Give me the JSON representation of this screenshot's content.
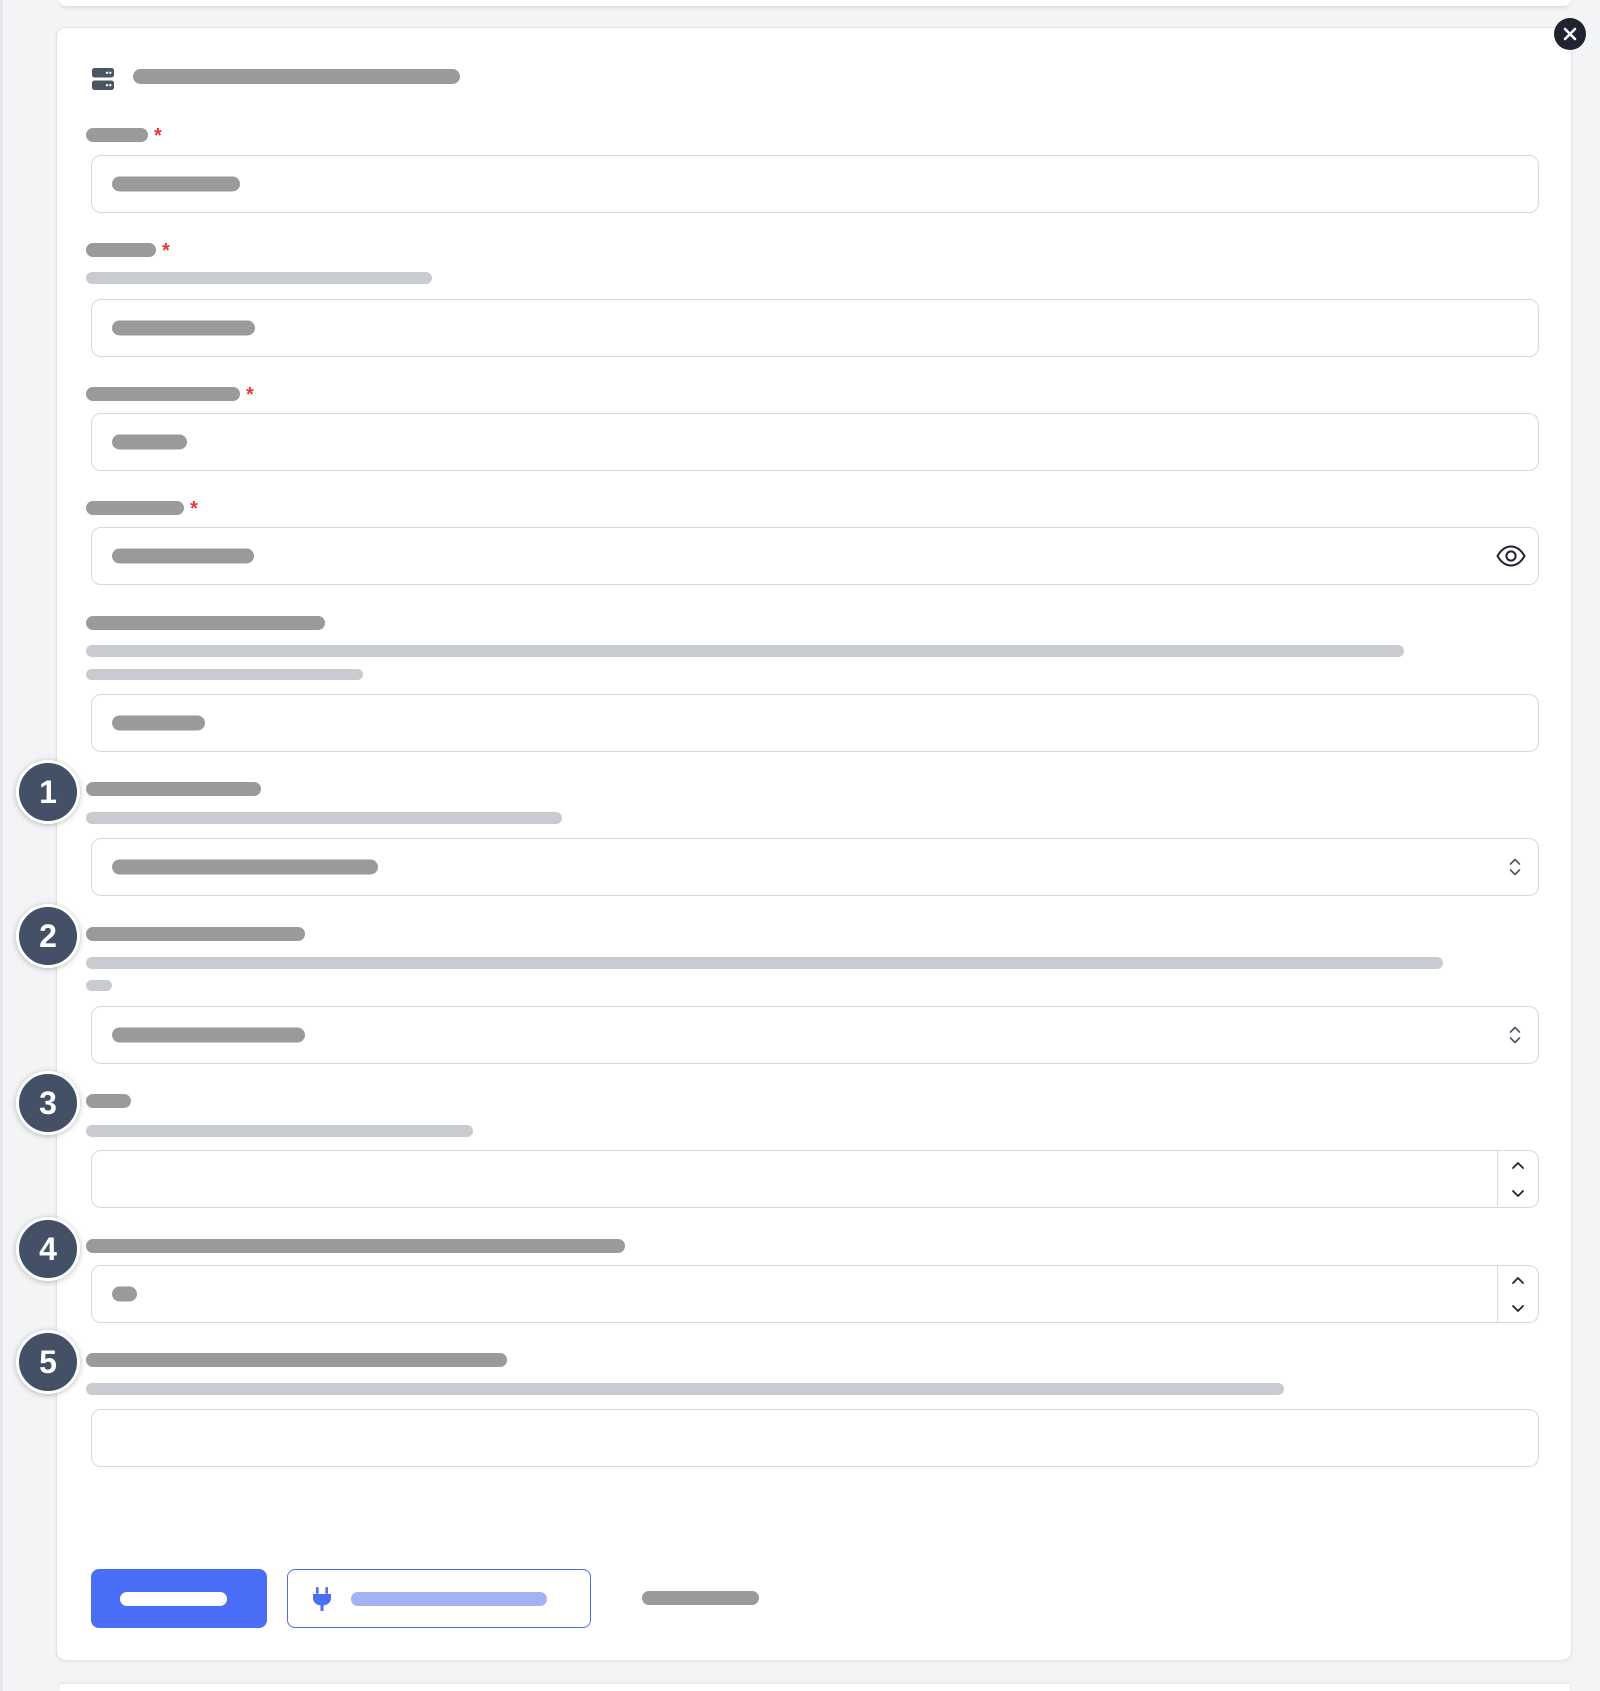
{
  "colors": {
    "accent": "#4a6ef5",
    "required": "#e53935",
    "badge": "#435065",
    "placeholder_bar": "#9a9a9a",
    "help_bar": "#c8ccd1"
  },
  "header": {
    "icon": "server-icon",
    "title": ""
  },
  "close": {
    "icon": "close-icon"
  },
  "fields": [
    {
      "label": "",
      "required_mark": "*",
      "value": ""
    },
    {
      "label": "",
      "required_mark": "*",
      "help": "",
      "value": ""
    },
    {
      "label": "",
      "required_mark": "*",
      "value": ""
    },
    {
      "label": "",
      "required_mark": "*",
      "value": "",
      "icon": "eye-icon"
    },
    {
      "label": "",
      "help": "",
      "value": ""
    },
    {
      "step": "1",
      "label": "",
      "help": "",
      "value": "",
      "icon": "chevron-up-down-icon"
    },
    {
      "step": "2",
      "label": "",
      "help": "",
      "value": "",
      "icon": "chevron-up-down-icon"
    },
    {
      "step": "3",
      "label": "",
      "help": "",
      "value": ""
    },
    {
      "step": "4",
      "label": "",
      "value": ""
    },
    {
      "step": "5",
      "label": "",
      "help": "",
      "value": ""
    }
  ],
  "actions": {
    "primary_label": "",
    "secondary_label": "",
    "secondary_icon": "plug-icon",
    "tertiary_label": ""
  }
}
